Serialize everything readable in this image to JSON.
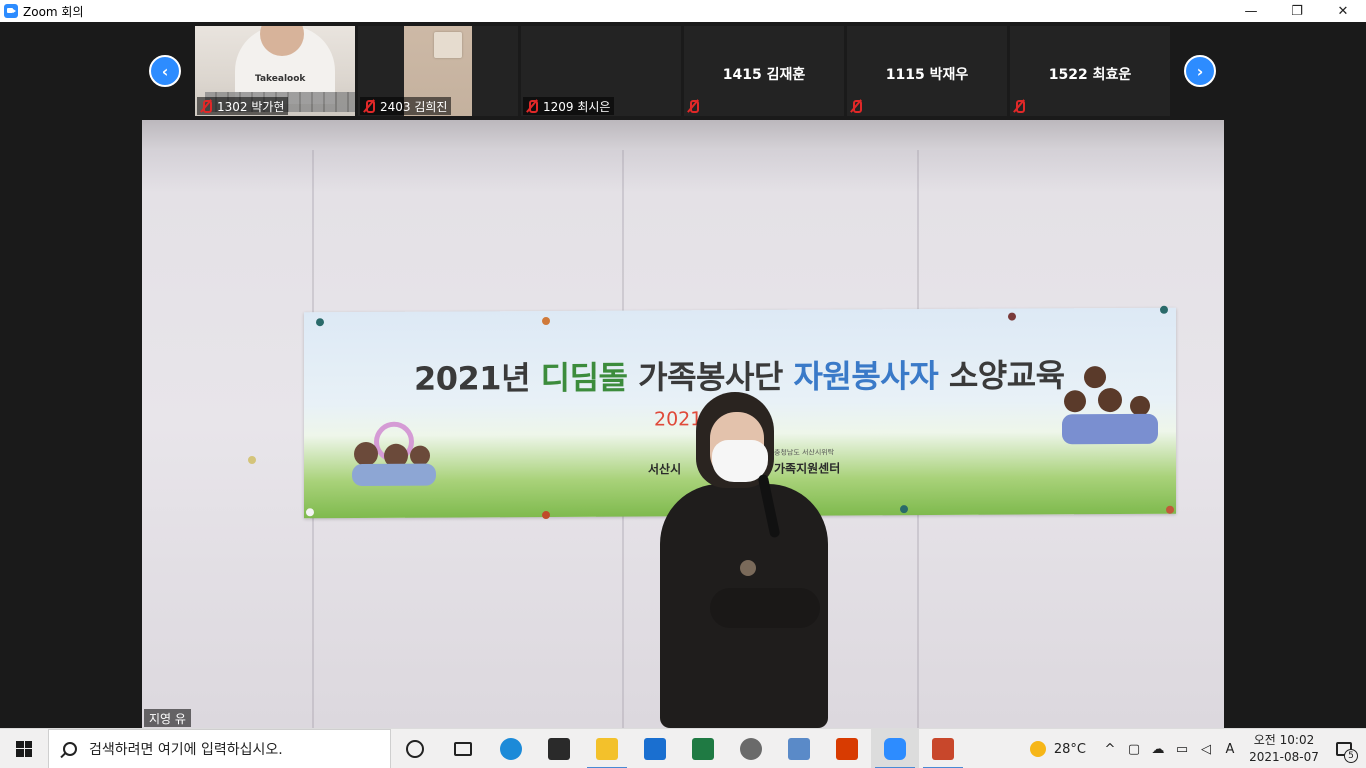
{
  "window": {
    "title": "Zoom 회의",
    "minimize": "—",
    "restore": "❐",
    "close": "✕"
  },
  "gallery": {
    "prev": "‹",
    "next": "›",
    "participants": [
      {
        "name": "1302 박가현",
        "muted": true,
        "video": true,
        "shirt_text": "Takealook"
      },
      {
        "name": "2403 김희진",
        "muted": true,
        "video": true
      },
      {
        "name": "1209 최시은",
        "muted": true,
        "video": false
      },
      {
        "name": "1415 김재훈",
        "muted": true,
        "video": false
      },
      {
        "name": "1115 박재우",
        "muted": true,
        "video": false
      },
      {
        "name": "1522 최효운",
        "muted": true,
        "video": false
      }
    ]
  },
  "main_video": {
    "speaker_name": "지영 유",
    "banner": {
      "title_part1": "2021년 ",
      "title_part2": "디딤돌 ",
      "title_part3": "가족봉사단 ",
      "title_part4": "자원봉사자 ",
      "title_part5": "소양교육",
      "date": "2021.             10:00",
      "org_left": "서산시",
      "org_right": "가족지원센터",
      "org_sub": "충청남도 서산시위탁"
    }
  },
  "taskbar": {
    "search_placeholder": "검색하려면 여기에 입력하십시오.",
    "apps": [
      {
        "name": "edge",
        "color": "#1c8ad8"
      },
      {
        "name": "store",
        "color": "#2a2a2a"
      },
      {
        "name": "file-explorer",
        "color": "#f3c12b"
      },
      {
        "name": "mail",
        "color": "#1a6fd0"
      },
      {
        "name": "excel",
        "color": "#1f7a43"
      },
      {
        "name": "capture",
        "color": "#6a6a6a"
      },
      {
        "name": "network-app",
        "color": "#5a8ac8"
      },
      {
        "name": "office",
        "color": "#d83b01"
      },
      {
        "name": "zoom",
        "color": "#2d8cff"
      },
      {
        "name": "powerpoint",
        "color": "#c8472b"
      }
    ],
    "weather_temp": "28°C",
    "tray_chevron": "^",
    "ime": "A",
    "clock_time": "오전 10:02",
    "clock_date": "2021-08-07",
    "notification_count": "5"
  }
}
